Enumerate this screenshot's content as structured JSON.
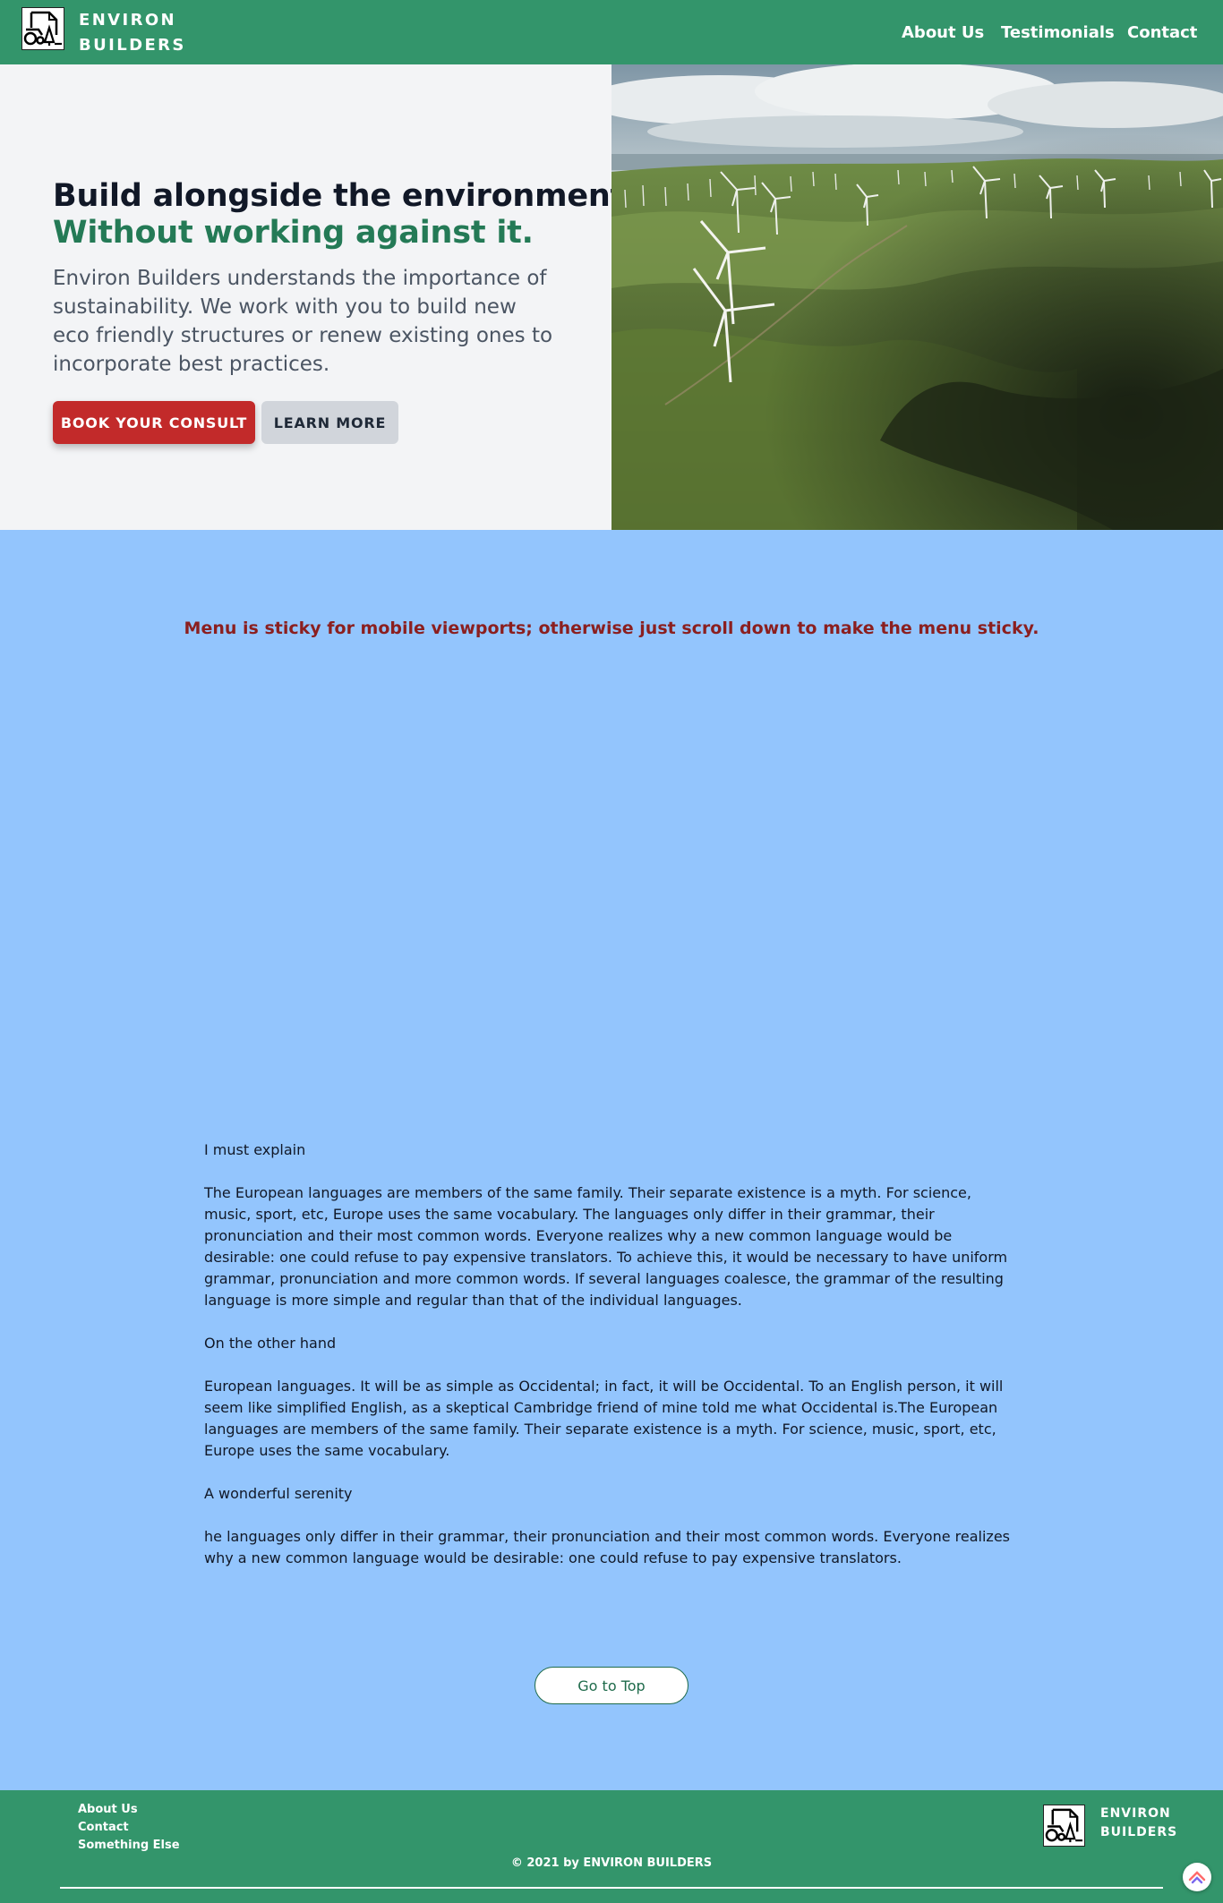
{
  "header": {
    "brand_line1": "ENVIRON",
    "brand_line2": "BUILDERS",
    "nav": [
      "About Us",
      "Testimonials",
      "Contact"
    ]
  },
  "hero": {
    "title_line1": "Build alongside the environment.",
    "title_line2": "Without working against it.",
    "description": "Environ Builders understands the importance of sustainability. We work with you to build new eco friendly structures or renew existing ones to incorporate best practices.",
    "primary_button": "BOOK YOUR CONSULT",
    "secondary_button": "LEARN MORE",
    "image_icon": "wind-farm-hills-photo"
  },
  "notice": "Menu is sticky for mobile viewports; otherwise just scroll down to make the menu sticky.",
  "article": [
    {
      "title": "I must explain",
      "text": "The European languages are members of the same family. Their separate existence is a myth. For science, music, sport, etc, Europe uses the same vocabulary. The languages only differ in their grammar, their pronunciation and their most common words. Everyone realizes why a new common language would be desirable: one could refuse to pay expensive translators. To achieve this, it would be necessary to have uniform grammar, pronunciation and more common words. If several languages coalesce, the grammar of the resulting language is more simple and regular than that of the individual languages."
    },
    {
      "title": "On the other hand",
      "text": "European languages. It will be as simple as Occidental; in fact, it will be Occidental. To an English person, it will seem like simplified English, as a skeptical Cambridge friend of mine told me what Occidental is.The European languages are members of the same family. Their separate existence is a myth. For science, music, sport, etc, Europe uses the same vocabulary."
    },
    {
      "title": "A wonderful serenity",
      "text": "he languages only differ in their grammar, their pronunciation and their most common words. Everyone realizes why a new common language would be desirable: one could refuse to pay expensive translators."
    }
  ],
  "go_top": "Go to Top",
  "footer": {
    "links": [
      "About Us",
      "Contact",
      "Something Else"
    ],
    "copyright": "© 2021 by ENVIRON BUILDERS",
    "brand_line1": "ENVIRON",
    "brand_line2": "BUILDERS"
  },
  "colors": {
    "nav_green": "#33956b",
    "accent_green": "#247a56",
    "primary_red": "#c22a2a",
    "page_blue": "#93c5fd",
    "notice_red": "#8b1f1f"
  }
}
